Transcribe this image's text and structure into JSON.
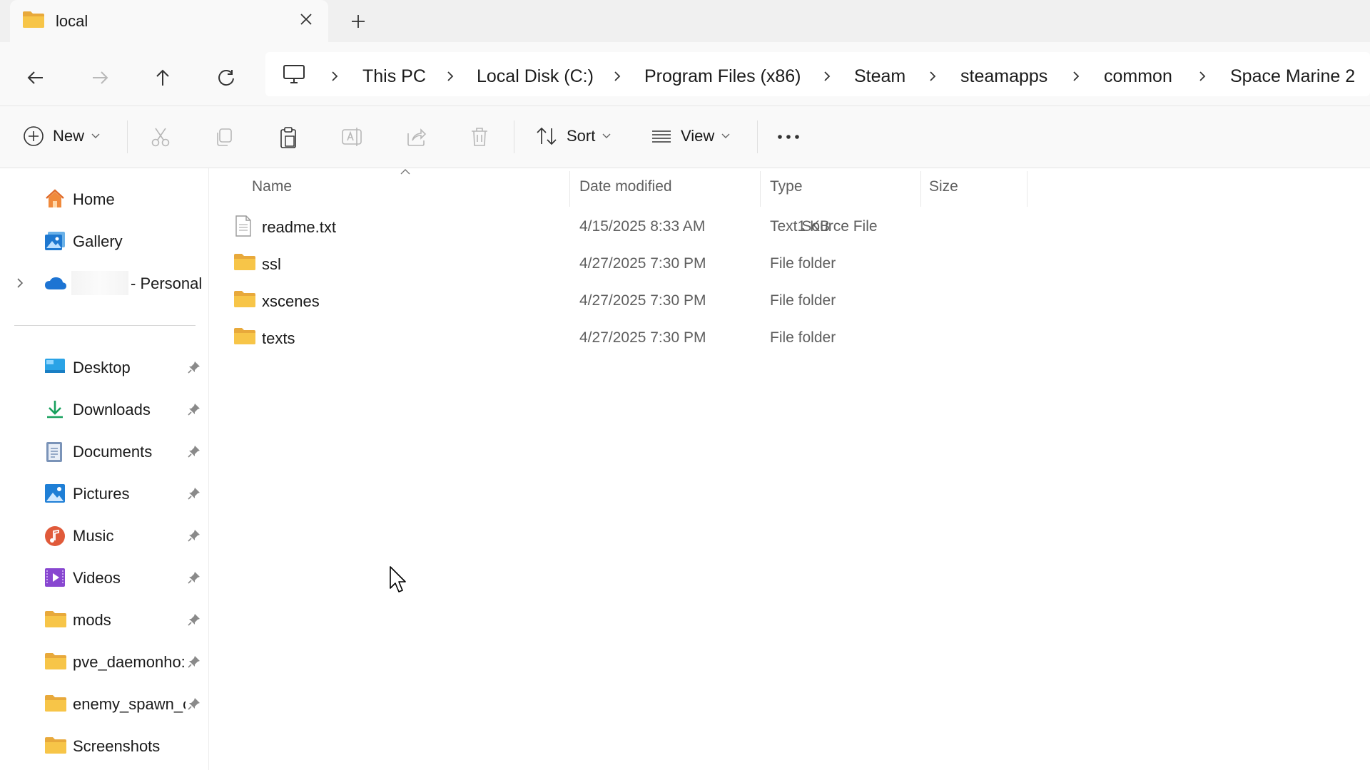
{
  "tab": {
    "title": "local",
    "close_icon": "close-icon",
    "new_tab_icon": "plus-icon"
  },
  "nav_buttons": [
    "back-arrow-icon",
    "forward-arrow-icon",
    "up-arrow-icon",
    "refresh-icon"
  ],
  "breadcrumb": {
    "root_icon": "monitor-icon",
    "items": [
      "This PC",
      "Local Disk (C:)",
      "Program Files (x86)",
      "Steam",
      "steamapps",
      "common",
      "Space Marine 2"
    ]
  },
  "toolbar": {
    "new_label": "New",
    "sort_label": "Sort",
    "view_label": "View",
    "icons": [
      "cut-icon",
      "copy-icon",
      "paste-icon",
      "rename-icon",
      "share-icon",
      "delete-icon",
      "more-icon"
    ]
  },
  "sidebar": {
    "home": "Home",
    "gallery": "Gallery",
    "onedrive": "- Personal",
    "quick_access": [
      {
        "label": "Desktop",
        "icon": "desktop-icon"
      },
      {
        "label": "Downloads",
        "icon": "download-icon"
      },
      {
        "label": "Documents",
        "icon": "documents-icon"
      },
      {
        "label": "Pictures",
        "icon": "pictures-icon"
      },
      {
        "label": "Music",
        "icon": "music-icon"
      },
      {
        "label": "Videos",
        "icon": "videos-icon"
      },
      {
        "label": "mods",
        "icon": "folder-icon"
      },
      {
        "label": "pve_daemonho:",
        "icon": "folder-icon"
      },
      {
        "label": "enemy_spawn_c",
        "icon": "folder-icon"
      },
      {
        "label": "Screenshots",
        "icon": "folder-icon"
      }
    ]
  },
  "columns": {
    "name": "Name",
    "date": "Date modified",
    "type": "Type",
    "size": "Size"
  },
  "files": [
    {
      "name": "readme.txt",
      "date": "4/15/2025 8:33 AM",
      "type": "Text Source File",
      "size": "1 KB",
      "icon": "text-file-icon"
    },
    {
      "name": "ssl",
      "date": "4/27/2025 7:30 PM",
      "type": "File folder",
      "size": "",
      "icon": "folder-icon"
    },
    {
      "name": "xscenes",
      "date": "4/27/2025 7:30 PM",
      "type": "File folder",
      "size": "",
      "icon": "folder-icon"
    },
    {
      "name": "texts",
      "date": "4/27/2025 7:30 PM",
      "type": "File folder",
      "size": "",
      "icon": "folder-icon"
    }
  ],
  "colors": {
    "folder": "#f7c548",
    "accent": "#0067c0",
    "chrome": "#f0f0f0",
    "toolbar": "#f9f9f9"
  }
}
